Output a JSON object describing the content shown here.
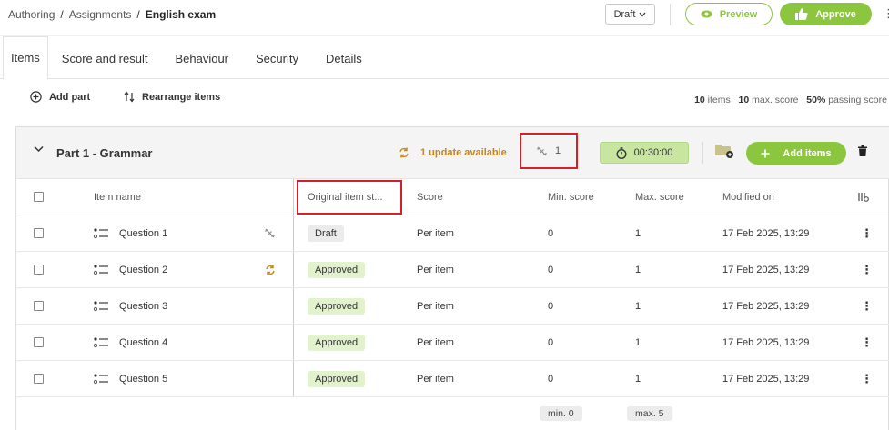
{
  "breadcrumb": {
    "root": "Authoring",
    "section": "Assignments",
    "current": "English exam",
    "separator": "/"
  },
  "header": {
    "status_select": "Draft",
    "preview_label": "Preview",
    "approve_label": "Approve"
  },
  "tabs": [
    {
      "label": "Items",
      "active": true
    },
    {
      "label": "Score and result"
    },
    {
      "label": "Behaviour"
    },
    {
      "label": "Security"
    },
    {
      "label": "Details"
    }
  ],
  "toolbar": {
    "add_part": "Add part",
    "rearrange": "Rearrange items",
    "summary": {
      "items_count": "10",
      "items_label": "items",
      "max_score": "10",
      "max_score_label": "max. score",
      "passing": "50%",
      "passing_label": "passing score"
    }
  },
  "part": {
    "title": "Part 1 - Grammar",
    "update_text": "1 update available",
    "unlinked_count": "1",
    "timer": "00:30:00",
    "add_items_label": "Add items"
  },
  "table": {
    "columns": {
      "name": "Item name",
      "original_status": "Original item st...",
      "score": "Score",
      "min_score": "Min. score",
      "max_score": "Max. score",
      "modified": "Modified on"
    },
    "rows": [
      {
        "name": "Question 1",
        "link": "unlinked",
        "status": "Draft",
        "score": "Per item",
        "min": "0",
        "max": "1",
        "modified": "17 Feb 2025, 13:29"
      },
      {
        "name": "Question 2",
        "link": "update",
        "status": "Approved",
        "score": "Per item",
        "min": "0",
        "max": "1",
        "modified": "17 Feb 2025, 13:29"
      },
      {
        "name": "Question 3",
        "link": "",
        "status": "Approved",
        "score": "Per item",
        "min": "0",
        "max": "1",
        "modified": "17 Feb 2025, 13:29"
      },
      {
        "name": "Question 4",
        "link": "",
        "status": "Approved",
        "score": "Per item",
        "min": "0",
        "max": "1",
        "modified": "17 Feb 2025, 13:29"
      },
      {
        "name": "Question 5",
        "link": "",
        "status": "Approved",
        "score": "Per item",
        "min": "0",
        "max": "1",
        "modified": "17 Feb 2025, 13:29"
      }
    ],
    "footer": {
      "min": "min. 0",
      "max": "max. 5"
    }
  },
  "colors": {
    "accent": "#8cc63f",
    "update": "#c2861e",
    "highlight": "#d62027"
  }
}
